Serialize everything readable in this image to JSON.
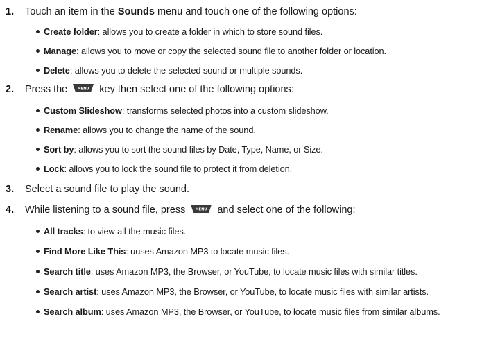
{
  "steps": [
    {
      "num": "1.",
      "pre": "Touch an item in the ",
      "bold": "Sounds",
      "post": " menu and touch one of the following options:",
      "bullets": [
        {
          "term": "Create folder",
          "desc": ": allows you to create a folder in which to store sound files."
        },
        {
          "term": "Manage",
          "desc": ": allows you to move or copy the selected sound file to another folder or location."
        },
        {
          "term": "Delete",
          "desc": ": allows you to delete the selected sound or multiple sounds."
        }
      ]
    },
    {
      "num": "2.",
      "pre": "Press the ",
      "post": " key then select one of the following options:",
      "bullets": [
        {
          "term": "Custom Slideshow",
          "desc": ": transforms selected photos into a custom slideshow."
        },
        {
          "term": "Rename",
          "desc": ": allows you to change the name of the sound."
        },
        {
          "term": "Sort by",
          "desc": ": allows you to sort the sound files by Date, Type, Name, or Size."
        },
        {
          "term": "Lock",
          "desc": ": allows you to lock the sound file to protect it from deletion."
        }
      ]
    },
    {
      "num": "3.",
      "text": "Select a sound file to play the sound."
    },
    {
      "num": "4.",
      "pre": "While listening to a sound file, press ",
      "post": " and select one of the following:",
      "bullets": [
        {
          "term": "All tracks",
          "desc": ": to view all the music files."
        },
        {
          "term": "Find More Like This",
          "desc": ": uuses Amazon MP3 to locate music files."
        },
        {
          "term": "Search title",
          "desc": ": uses Amazon MP3, the Browser, or YouTube, to locate music files with similar titles."
        },
        {
          "term": "Search artist",
          "desc": ": uses Amazon MP3, the Browser, or YouTube, to locate music files with similar artists."
        },
        {
          "term": "Search album",
          "desc": ": uses Amazon MP3, the Browser, or YouTube, to locate music files from similar albums."
        }
      ]
    }
  ],
  "menu_key_label": "MENU",
  "menu_key_icon": "menu-key-icon"
}
